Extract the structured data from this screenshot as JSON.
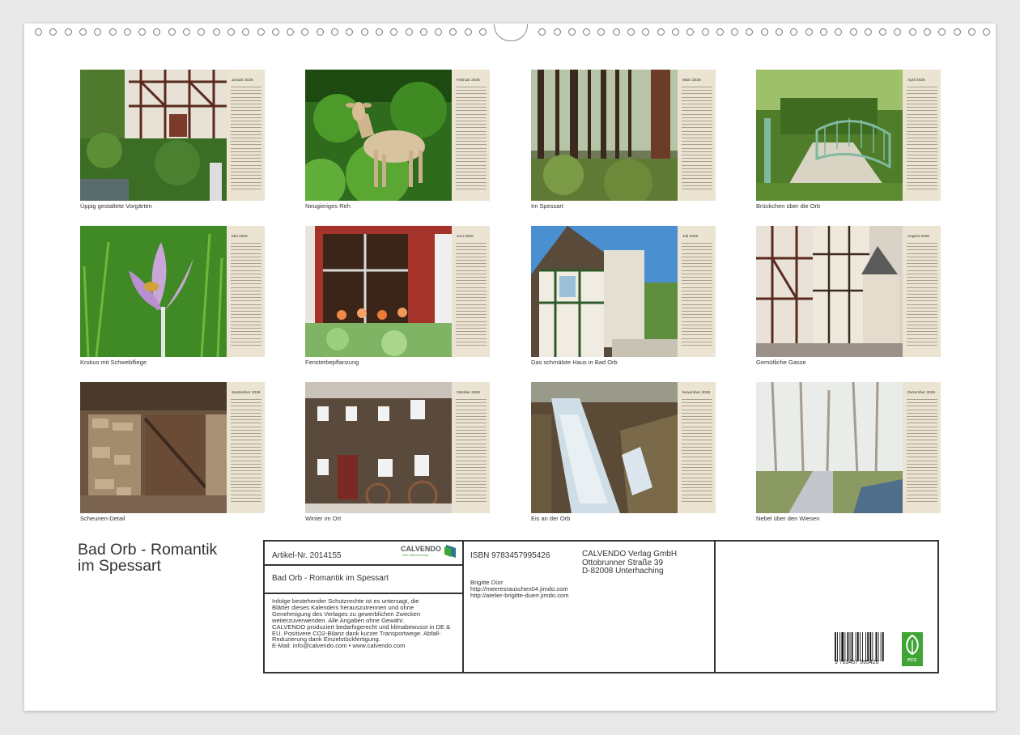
{
  "months": [
    {
      "label": "Januar 2026",
      "caption": "Üppig gestaltete Vorgärten"
    },
    {
      "label": "Februar 2026",
      "caption": "Neugieriges Reh"
    },
    {
      "label": "März 2026",
      "caption": "Im Spessart"
    },
    {
      "label": "April 2026",
      "caption": "Brückchen über die Orb"
    },
    {
      "label": "Mai 2026",
      "caption": "Krokus mit Schwebfliege"
    },
    {
      "label": "Juni 2026",
      "caption": "Fensterbepflanzung"
    },
    {
      "label": "Juli 2026",
      "caption": "Das schmälste Haus in Bad Orb"
    },
    {
      "label": "August 2026",
      "caption": "Gemütliche Gasse"
    },
    {
      "label": "September 2026",
      "caption": "Scheunen-Detail"
    },
    {
      "label": "Oktober 2026",
      "caption": "Winter im Ort"
    },
    {
      "label": "November 2026",
      "caption": "Eis an der Orb"
    },
    {
      "label": "Dezember 2026",
      "caption": "Nebel über den Wiesen"
    }
  ],
  "title": {
    "line1": "Bad Orb - Romantik",
    "line2": "im Spessart"
  },
  "info": {
    "article": "Artikel-Nr. 2014155",
    "brand": "CALVENDO",
    "brand_sub": "Dein Kalenderverlag",
    "book_title": "Bad Orb - Romantik im Spessart",
    "legal": [
      "Infolge bestehender Schutzrechte ist es untersagt, die",
      "Blätter dieses Kalenders herauszutrennen und ohne",
      "Genehmigung des Verlages zu gewerblichen Zwecken",
      "weiterzuverwenden. Alle Angaben ohne Gewähr.",
      "CALVENDO produziert bedarfsgerecht und klimabewusst in DE &",
      "EU. Positivere CO2-Bilanz dank kurzer Transportwege. Abfall-",
      "Reduzierung dank Einzelstückfertigung.",
      "E-Mail: info@calvendo.com • www.calvendo.com"
    ],
    "isbn": "ISBN 9783457995426",
    "publisher": [
      "CALVENDO Verlag GmbH",
      "Ottobrunner Straße 39",
      "D-82008 Unterhaching"
    ],
    "author": [
      "Brigitte Dürr",
      "http://meeresrauschen04.jimdo.com",
      "http://atelier-brigitte-duerr.jimdo.com"
    ],
    "barcode_digits": "9 783457 995426",
    "eco_label": "eco"
  },
  "colors": {
    "accent": "#3fa535",
    "calendar_strip": "#ece4d3",
    "paper": "#ffffff"
  }
}
